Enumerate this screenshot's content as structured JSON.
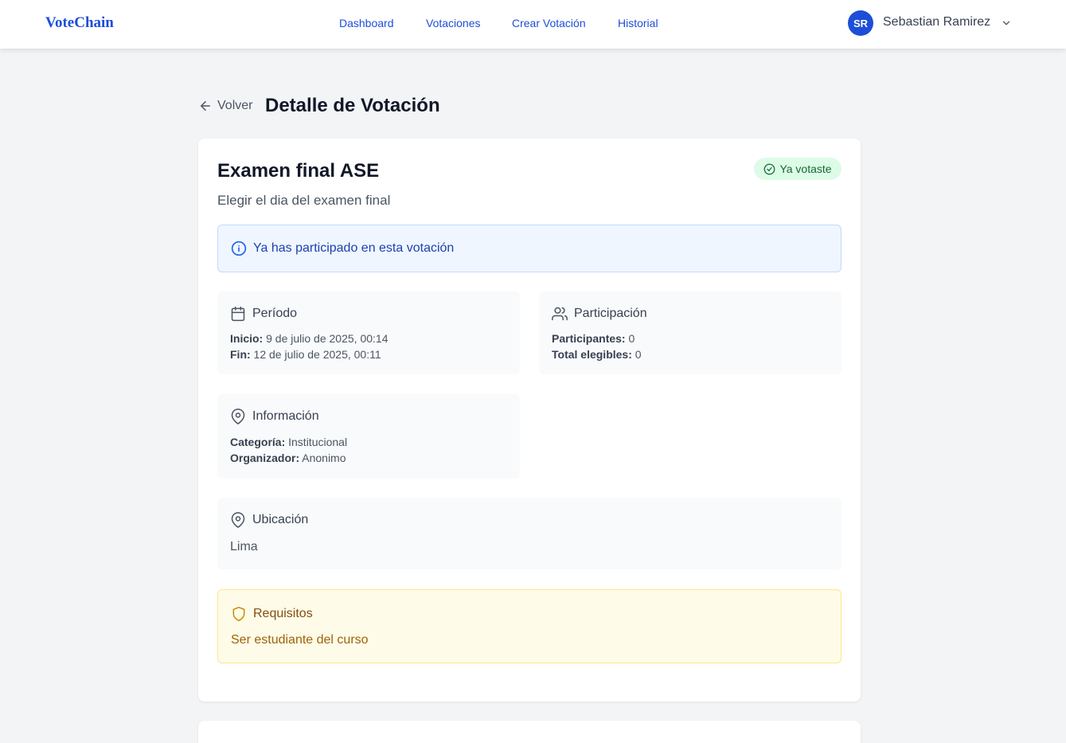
{
  "navbar": {
    "brand": "VoteChain",
    "links": [
      "Dashboard",
      "Votaciones",
      "Crear Votación",
      "Historial"
    ],
    "user": {
      "initials": "SR",
      "name": "Sebastian Ramirez"
    }
  },
  "header": {
    "back_label": "Volver",
    "title": "Detalle de Votación"
  },
  "vote": {
    "title": "Examen final ASE",
    "status_badge": "Ya votaste",
    "description": "Elegir el dia del examen final",
    "alert": "Ya has participado en esta votación",
    "periodo": {
      "heading": "Período",
      "start_label": "Inicio:",
      "start_value": "9 de julio de 2025, 00:14",
      "end_label": "Fin:",
      "end_value": "12 de julio de 2025, 00:11"
    },
    "participacion": {
      "heading": "Participación",
      "participants_label": "Participantes:",
      "participants_value": "0",
      "eligible_label": "Total elegibles:",
      "eligible_value": "0"
    },
    "informacion": {
      "heading": "Información",
      "category_label": "Categoría:",
      "category_value": "Institucional",
      "organizer_label": "Organizador:",
      "organizer_value": "Anonimo"
    },
    "ubicacion": {
      "heading": "Ubicación",
      "value": "Lima"
    },
    "requisitos": {
      "heading": "Requisitos",
      "value": "Ser estudiante del curso"
    }
  }
}
